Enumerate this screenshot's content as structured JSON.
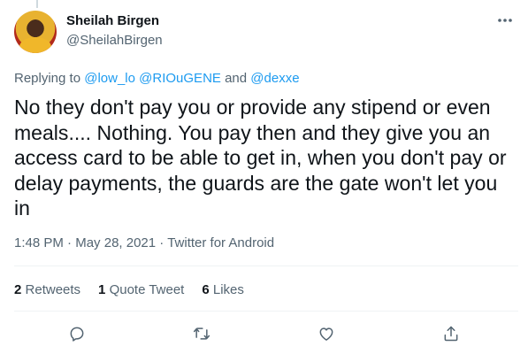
{
  "author": {
    "display_name": "Sheilah Birgen",
    "handle": "@SheilahBirgen"
  },
  "reply_context": {
    "prefix": "Replying to",
    "mentions": [
      "@low_lo",
      "@RIOuGENE",
      "@dexxe"
    ],
    "conjunction": "and"
  },
  "tweet": {
    "text": "No they don't pay you or provide any stipend or even meals.... Nothing. You pay then and they give you an access card to be able to get in, when you don't pay or delay payments, the guards are the gate won't let you in",
    "time": "1:48 PM",
    "date": "May 28, 2021",
    "source": "Twitter for Android",
    "separator": "·"
  },
  "stats": {
    "retweets_count": "2",
    "retweets_label": "Retweets",
    "quotes_count": "1",
    "quotes_label": "Quote Tweet",
    "likes_count": "6",
    "likes_label": "Likes"
  },
  "colors": {
    "link": "#1d9bf0",
    "secondary_text": "#536471",
    "primary_text": "#0f1419",
    "divider": "#eff3f4"
  },
  "icons": {
    "more": "more-dots-icon",
    "reply": "reply-icon",
    "retweet": "retweet-icon",
    "like": "like-icon",
    "share": "share-icon"
  }
}
